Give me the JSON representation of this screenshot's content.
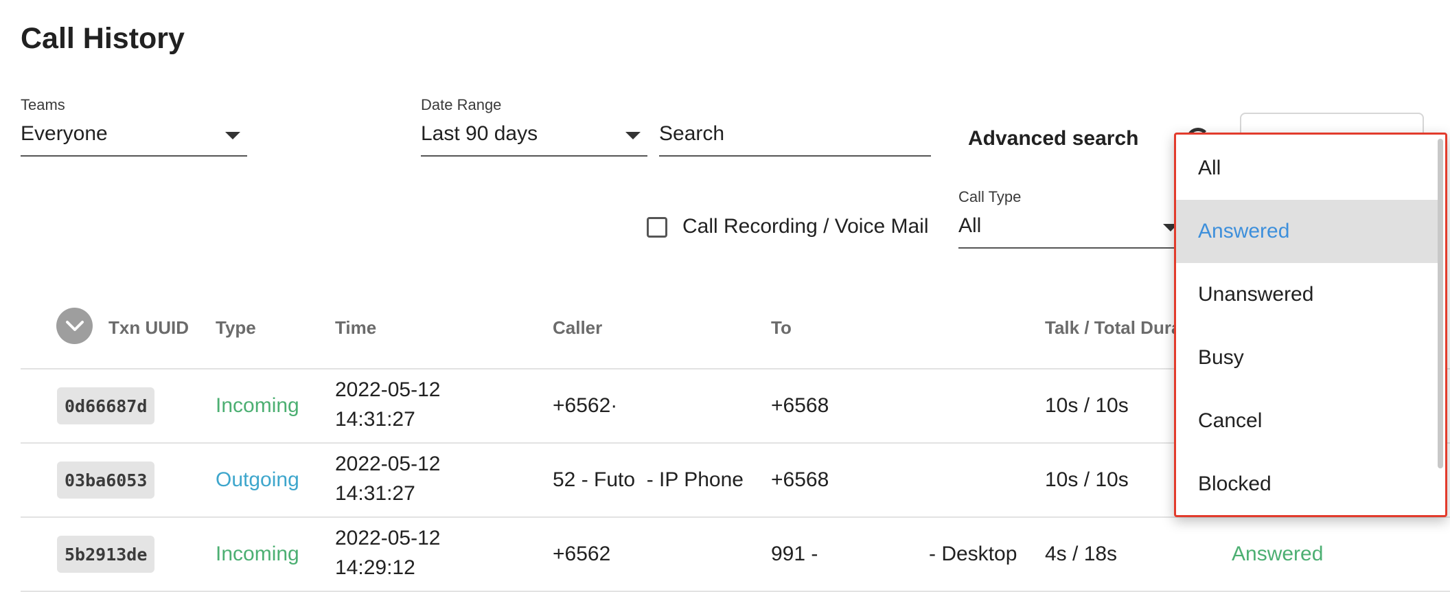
{
  "page": {
    "title": "Call History"
  },
  "filters": {
    "teams": {
      "label": "Teams",
      "value": "Everyone"
    },
    "date_range": {
      "label": "Date Range",
      "value": "Last 90 days"
    },
    "search": {
      "placeholder": "Search"
    },
    "advanced_search_label": "Advanced search",
    "call_recording_label": "Call Recording / Voice Mail",
    "call_type": {
      "label": "Call Type",
      "value": "All"
    }
  },
  "table": {
    "columns": [
      "Txn UUID",
      "Type",
      "Time",
      "Caller",
      "To",
      "Talk / Total Dura"
    ],
    "rows": [
      {
        "uuid": "0d66687d",
        "type": "Incoming",
        "date": "2022-05-12",
        "time": "14:31:27",
        "caller": "+6562·",
        "to": "+6568",
        "duration": "10s / 10s",
        "status": ""
      },
      {
        "uuid": "03ba6053",
        "type": "Outgoing",
        "date": "2022-05-12",
        "time": "14:31:27",
        "caller": "52 - Futo  - IP Phone",
        "to": "+6568",
        "duration": "10s / 10s",
        "status": ""
      },
      {
        "uuid": "5b2913de",
        "type": "Incoming",
        "date": "2022-05-12",
        "time": "14:29:12",
        "caller": "+6562",
        "to": "991 -",
        "to_suffix": "- Desktop",
        "duration": "4s / 18s",
        "status": "Answered"
      }
    ]
  },
  "dropdown_menu": {
    "options": [
      "All",
      "Answered",
      "Unanswered",
      "Busy",
      "Cancel",
      "Blocked"
    ],
    "selected": "Answered"
  },
  "colors": {
    "incoming": "#4caf72",
    "outgoing": "#3ea6cc",
    "selected_option": "#3d8fdb",
    "highlight_border": "#e23b2c"
  }
}
